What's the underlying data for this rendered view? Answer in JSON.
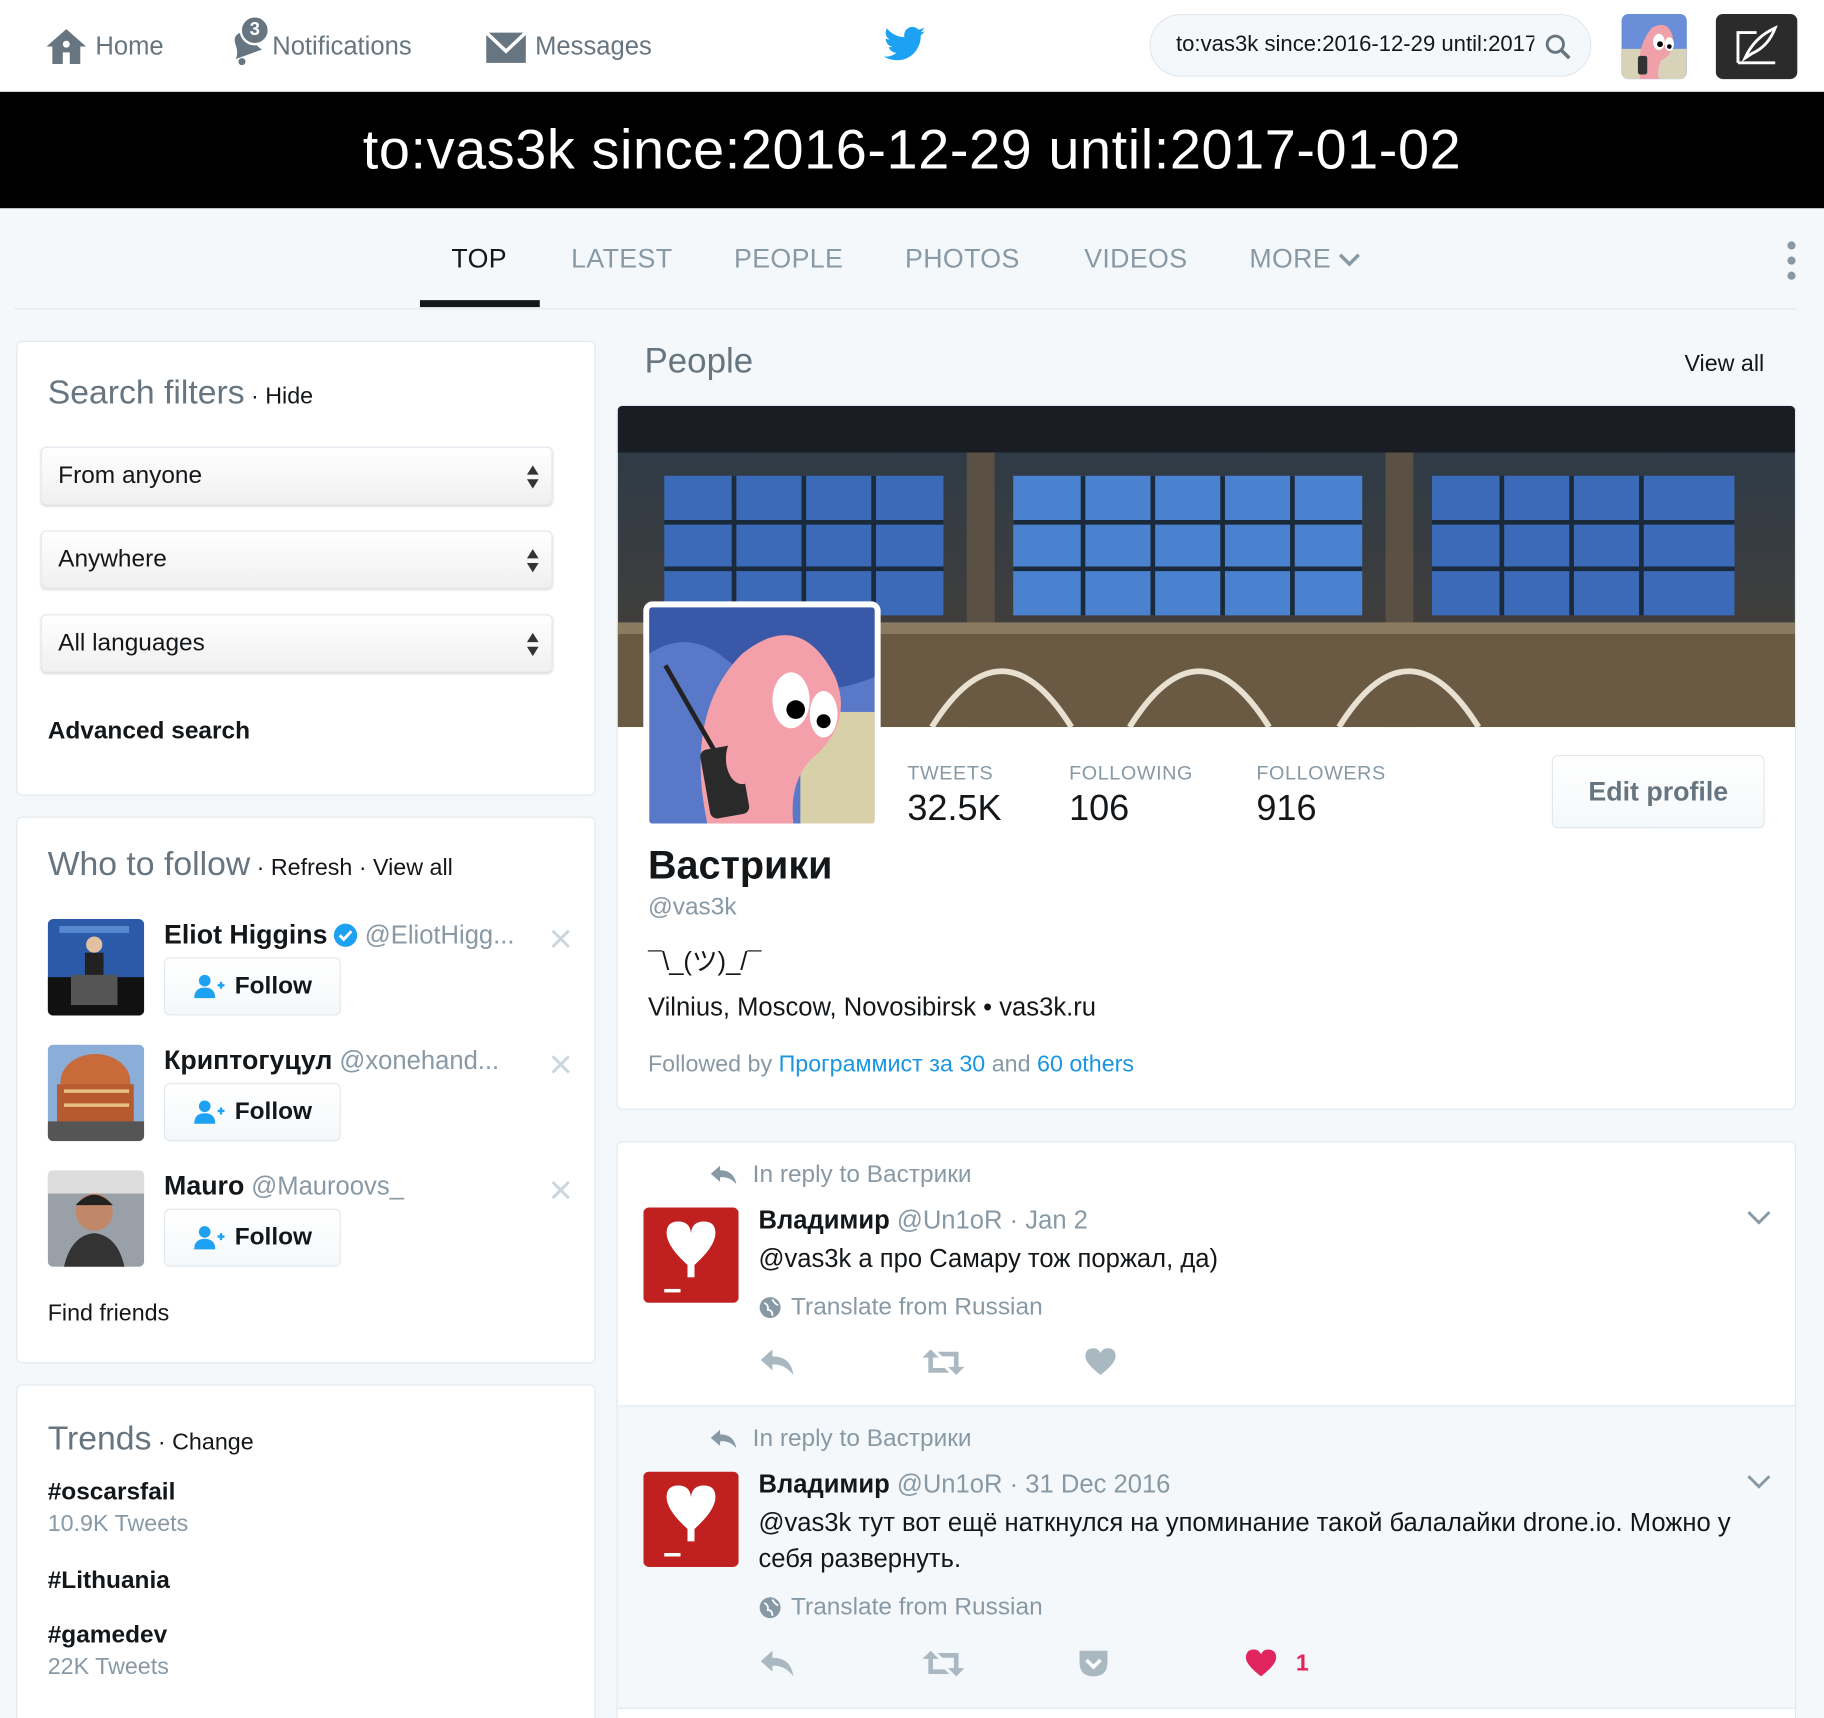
{
  "nav": {
    "home": "Home",
    "notifications": "Notifications",
    "notification_count": "3",
    "messages": "Messages",
    "search_value": "to:vas3k since:2016-12-29 until:2017-01-02"
  },
  "search_heading": "to:vas3k since:2016-12-29 until:2017-01-02",
  "tabs": [
    {
      "label": "TOP",
      "active": true
    },
    {
      "label": "LATEST"
    },
    {
      "label": "PEOPLE"
    },
    {
      "label": "PHOTOS"
    },
    {
      "label": "VIDEOS"
    },
    {
      "label": "MORE"
    }
  ],
  "filters": {
    "title": "Search filters",
    "hide": "Hide",
    "from": "From anyone",
    "where": "Anywhere",
    "language": "All languages",
    "advanced": "Advanced search"
  },
  "who_to_follow": {
    "title": "Who to follow",
    "refresh": "Refresh",
    "view_all": "View all",
    "follow_label": "Follow",
    "items": [
      {
        "name": "Eliot Higgins",
        "handle": "@EliotHigg...",
        "verified": true
      },
      {
        "name": "Криптогуцул",
        "handle": "@xonehand..."
      },
      {
        "name": "Mauro",
        "handle": "@Mauroovs_"
      }
    ],
    "find_friends": "Find friends"
  },
  "trends": {
    "title": "Trends",
    "change": "Change",
    "items": [
      {
        "name": "#oscarsfail",
        "count": "10.9K Tweets"
      },
      {
        "name": "#Lithuania",
        "count": ""
      },
      {
        "name": "#gamedev",
        "count": "22K Tweets"
      }
    ]
  },
  "people": {
    "label": "People",
    "view_all": "View all",
    "profile": {
      "name": "Вастрики",
      "handle": "@vas3k",
      "bio": "¯\\_(ツ)_/¯",
      "location": "Vilnius, Moscow, Novosibirsk",
      "website": "vas3k.ru",
      "followed_by_prefix": "Followed by",
      "followed_by_user": "Программист за 30",
      "followed_by_and": "and",
      "followed_by_others": "60 others",
      "edit_profile": "Edit profile",
      "stats": {
        "tweets_label": "TWEETS",
        "tweets": "32.5K",
        "following_label": "FOLLOWING",
        "following": "106",
        "followers_label": "FOLLOWERS",
        "followers": "916"
      }
    }
  },
  "tweets": [
    {
      "reply_context": "In reply to Вастрики",
      "name": "Владимир",
      "handle": "@Un1oR",
      "time": "Jan 2",
      "text": "@vas3k а про Самару тож поржал, да)",
      "translate": "Translate from Russian",
      "likes": ""
    },
    {
      "reply_context": "In reply to Вастрики",
      "name": "Владимир",
      "handle": "@Un1oR",
      "time": "31 Dec 2016",
      "text": "@vas3k тут вот ещё наткнулся на упоминание такой балалайки drone.io. Можно у себя развернуть.",
      "translate": "Translate from Russian",
      "likes": "1"
    }
  ],
  "colors": {
    "accent": "#1da1f2",
    "link": "#1b95e0",
    "like": "#e0245e",
    "muted": "#8899a6"
  }
}
